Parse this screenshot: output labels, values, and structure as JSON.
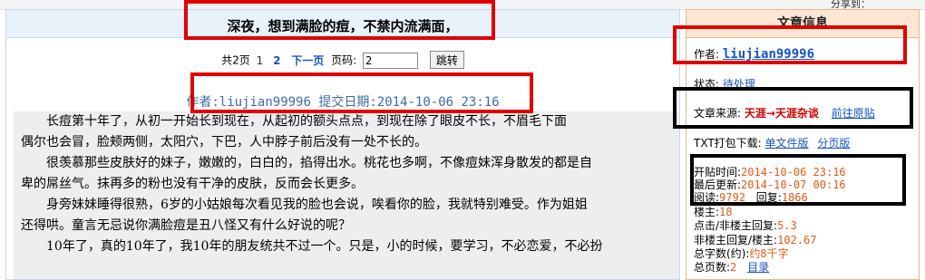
{
  "topbar": {
    "share_label": "分享到："
  },
  "article": {
    "title": "深夜，想到满脸的痘，不禁内流满面，",
    "pager": {
      "total": "共2页",
      "page1": "1",
      "page2": "2",
      "next": "下一页",
      "goto_label": "页码:",
      "goto_value": "2",
      "goto_button": "跳转"
    },
    "byline": "作者:liujian99996 提交日期:2014-10-06 23:16",
    "paragraphs": [
      "　　长痘第十年了，从初一开始长到现在，从起初的额头点点，到现在除了眼皮不长，不眉毛下面",
      "偶尔也会冒，脸颊两侧，太阳穴，下巴，人中脖子前后没有一处不长的。",
      "　　很羡慕那些皮肤好的妹子，嫩嫩的，白白的，掐得出水。桃花也多啊，不像痘妹浑身散发的都是自",
      "卑的屌丝气。抹再多的粉也没有干净的皮肤，反而会长更多。",
      "　　身旁妹妹睡得很熟，6岁的小姑娘每次看见我的脸也会说，唉看你的脸，我就特别难受。作为姐姐",
      "还得哄。童言无忌说你满脸痘是丑八怪又有什么好说的呢？",
      "　　10年了，真的10年了，我10年的朋友统共不过一个。只是，小的时候，要学习，不必恋爱，不必扮"
    ]
  },
  "sidebar": {
    "header": "文章信息",
    "author_label": "作者:",
    "author_name": "liujian99996",
    "status_label": "状态:",
    "status_value": "待处理",
    "source_label": "文章来源:",
    "source_value": "天涯→天涯杂谈",
    "source_link": "前往原贴",
    "txt_label": "TXT打包下载:",
    "txt_single": "单文件版",
    "txt_paged": "分页版",
    "start_label": "开贴时间:",
    "start_value": "2014-10-06 23:16",
    "update_label": "最后更新:",
    "update_value": "2014-10-07 00:16",
    "read_label": "阅读:",
    "read_value": "9792",
    "reply_label": "回复:",
    "reply_value": "1866",
    "floor_label": "楼主:",
    "floor_value": "18",
    "click_label": "点击/非楼主回复:",
    "click_value": "5.3",
    "nonfloor_label": "非楼主回复/楼主:",
    "nonfloor_value": "102.67",
    "words_label": "总字数(约):",
    "words_value": "约8千字",
    "pages_label": "总页数:",
    "pages_value": "2",
    "toc_link": "目录"
  }
}
